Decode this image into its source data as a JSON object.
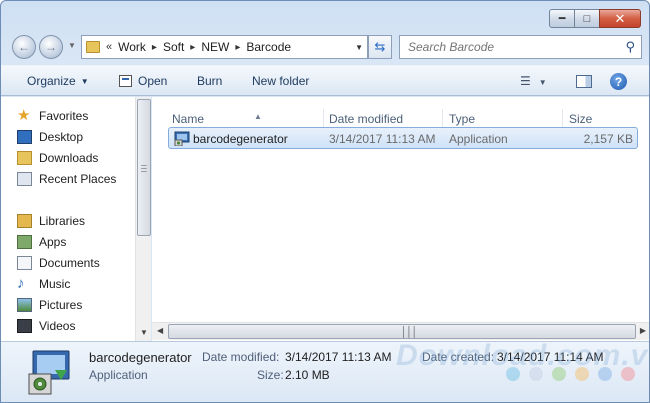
{
  "address_bar": {
    "overflow": "«",
    "crumbs": [
      "Work",
      "Soft",
      "NEW",
      "Barcode"
    ],
    "separator": "▸"
  },
  "search": {
    "placeholder": "Search Barcode"
  },
  "toolbar": {
    "organize": "Organize",
    "open": "Open",
    "burn": "Burn",
    "new_folder": "New folder"
  },
  "nav_pane": {
    "favorites": "Favorites",
    "desktop": "Desktop",
    "downloads": "Downloads",
    "recent_places": "Recent Places",
    "libraries": "Libraries",
    "apps": "Apps",
    "documents": "Documents",
    "music": "Music",
    "pictures": "Pictures",
    "videos": "Videos"
  },
  "columns": {
    "name": "Name",
    "date_modified": "Date modified",
    "type": "Type",
    "size": "Size"
  },
  "files": [
    {
      "name": "barcodegenerator",
      "date_modified": "3/14/2017 11:13 AM",
      "type": "Application",
      "size": "2,157 KB"
    }
  ],
  "details": {
    "name": "barcodegenerator",
    "type": "Application",
    "date_modified_label": "Date modified:",
    "date_modified": "3/14/2017 11:13 AM",
    "size_label": "Size:",
    "size": "2.10 MB",
    "date_created_label": "Date created:",
    "date_created": "3/14/2017 11:14 AM"
  },
  "watermark": "Download.com.vn",
  "colors": {
    "selection": "#cfe2f8",
    "selection_border": "#84acdd",
    "toolbar_text": "#1e3a5f"
  }
}
